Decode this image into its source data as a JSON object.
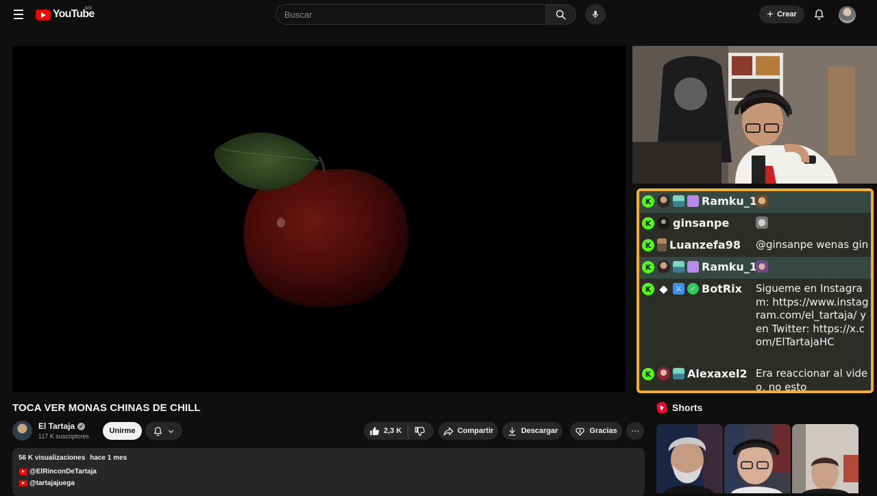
{
  "header": {
    "logo_text": "YouTube",
    "logo_country": "MX",
    "search_placeholder": "Buscar",
    "create_label": "Crear"
  },
  "video": {
    "title": "TOCA VER MONAS CHINAS DE CHILL",
    "channel_name": "El Tartaja",
    "subscribers": "117 K suscriptores",
    "join_label": "Unirme",
    "likes": "2,3 K",
    "share_label": "Compartir",
    "download_label": "Descargar",
    "thanks_label": "Gracias"
  },
  "description": {
    "views": "56 K visualizaciones",
    "date": "hace 1 mes",
    "links": [
      "@ElRinconDeTartaja",
      "@tartajajuega"
    ]
  },
  "chat": {
    "messages": [
      {
        "user": "Ramku_1",
        "text": ""
      },
      {
        "user": "ginsanpe",
        "text": ""
      },
      {
        "user": "Luanzefa98",
        "text": "@ginsanpe wenas gin"
      },
      {
        "user": "Ramku_1",
        "text": ""
      },
      {
        "user": "BotRix",
        "text": "Sigueme en Instagram: https://www.instagram.com/el_tartaja/ y en Twitter: https://x.com/ElTartajaHC"
      },
      {
        "user": "Alexaxel2",
        "text": "Era reaccionar al video, no esto"
      }
    ]
  },
  "sidebar": {
    "shorts_title": "Shorts"
  },
  "colors": {
    "background": "#0f0f0f",
    "chat_border": "#f0b02a",
    "kick_green": "#53fc18",
    "youtube_red": "#ff0000"
  },
  "icons": [
    "menu-icon",
    "search-icon",
    "mic-icon",
    "plus-icon",
    "bell-icon",
    "verified-icon",
    "chevron-down-icon",
    "thumbs-up-icon",
    "thumbs-down-icon",
    "share-icon",
    "download-icon",
    "thanks-icon",
    "more-icon",
    "shorts-icon"
  ]
}
